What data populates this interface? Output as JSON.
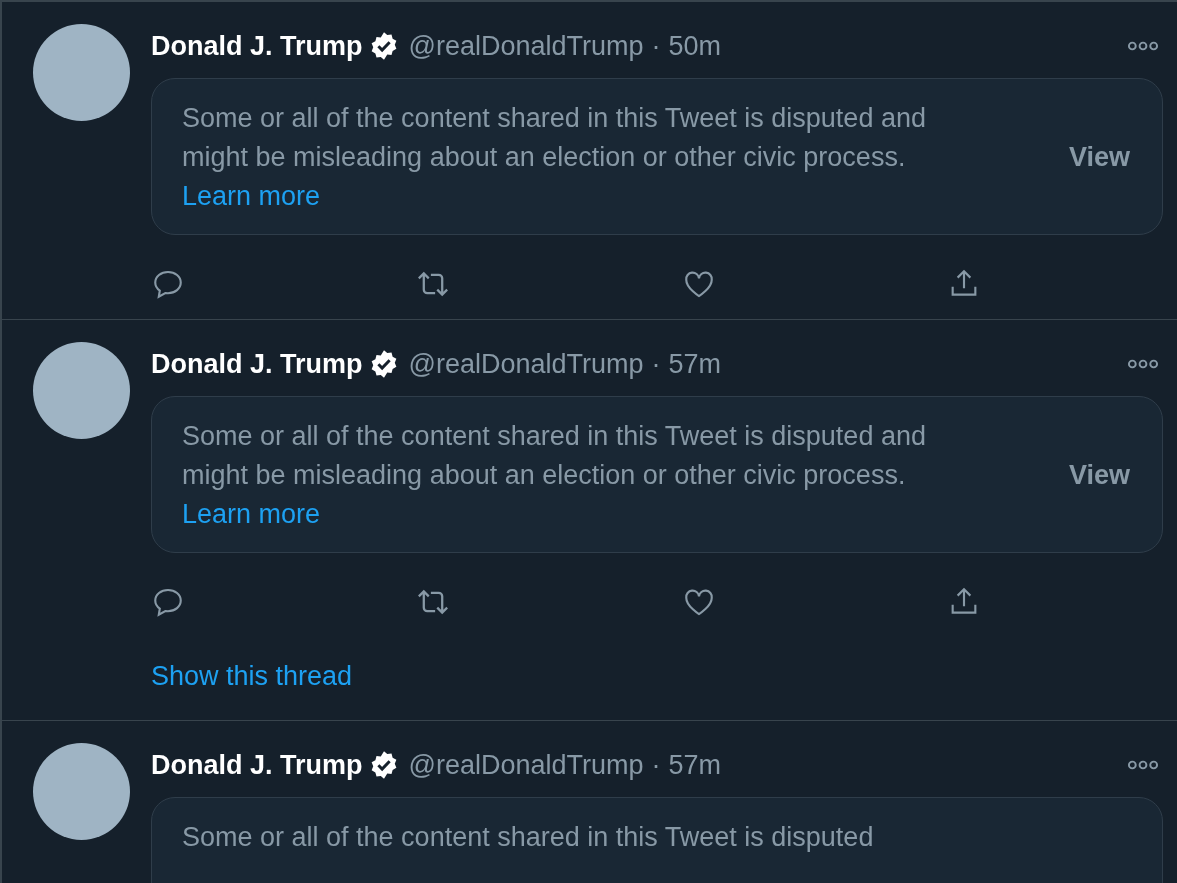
{
  "tweets": [
    {
      "name": "Donald J. Trump",
      "verified": true,
      "handle": "@realDonaldTrump",
      "separator": "·",
      "time": "50m",
      "notice": {
        "text": "Some or all of the content shared in this Tweet is disputed and might be misleading about an election or other civic process.",
        "link": "Learn more",
        "button": "View"
      },
      "actions": true
    },
    {
      "name": "Donald J. Trump",
      "verified": true,
      "handle": "@realDonaldTrump",
      "separator": "·",
      "time": "57m",
      "notice": {
        "text": "Some or all of the content shared in this Tweet is disputed and might be misleading about an election or other civic process.",
        "link": "Learn more",
        "button": "View"
      },
      "actions": true,
      "thread_link": "Show this thread"
    },
    {
      "name": "Donald J. Trump",
      "verified": true,
      "handle": "@realDonaldTrump",
      "separator": "·",
      "time": "57m",
      "notice": {
        "text": "Some or all of the content shared in this Tweet is disputed"
      },
      "actions": false
    }
  ]
}
